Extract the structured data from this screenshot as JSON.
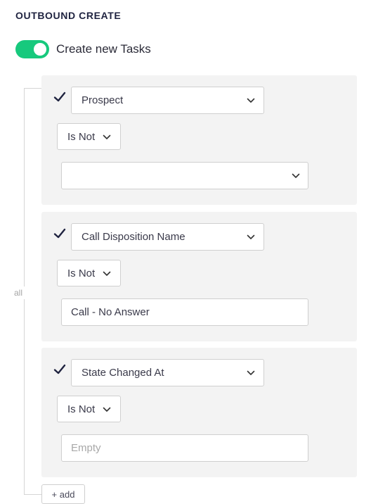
{
  "section": {
    "title": "OUTBOUND CREATE"
  },
  "toggle": {
    "label": "Create new Tasks",
    "state": "on",
    "color": "#17c97d"
  },
  "group": {
    "label": "all"
  },
  "conditions": [
    {
      "checked": true,
      "field": "Prospect",
      "operator": "Is Not",
      "value": "",
      "value_type": "dropdown"
    },
    {
      "checked": true,
      "field": "Call Disposition Name",
      "operator": "Is Not",
      "value": "Call - No Answer",
      "value_type": "text"
    },
    {
      "checked": true,
      "field": "State Changed At",
      "operator": "Is Not",
      "value": "",
      "placeholder": "Empty",
      "value_type": "text"
    }
  ],
  "add_button": {
    "label": "+ add"
  },
  "icons": {
    "check": "check-icon",
    "chevron": "chevron-down-icon"
  }
}
